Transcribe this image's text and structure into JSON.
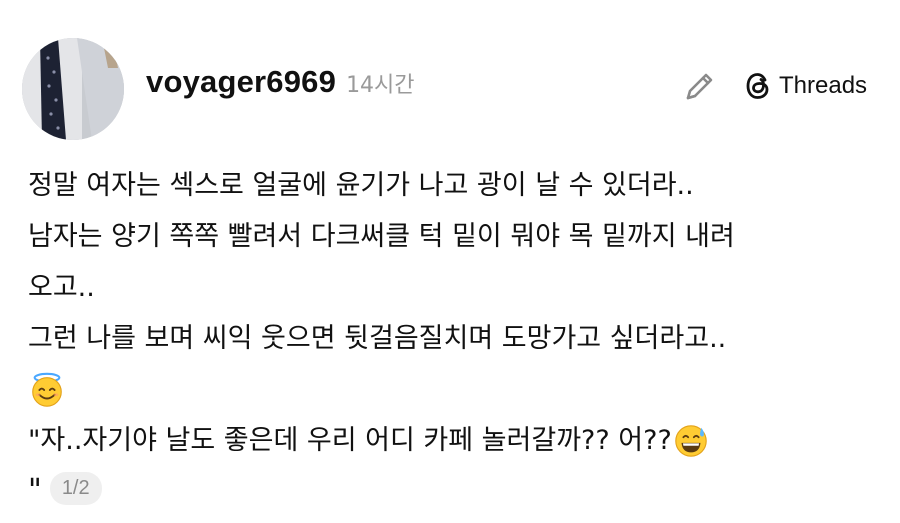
{
  "author": {
    "username": "voyager6969",
    "time_ago": "14시간"
  },
  "brand": {
    "label": "Threads"
  },
  "post": {
    "lines": [
      "정말 여자는 섹스로 얼굴에 윤기가 나고 광이 날 수 있더라..",
      "남자는 양기 쪽쪽 빨려서 다크써클 턱 밑이 뭐야 목 밑까지 내려",
      "오고..",
      "그런 나를 보며 씨익 웃으면 뒷걸음질치며 도망가고 싶더라고..",
      "\"자..자기야 날도 좋은데 우리 어디 카페 놀러갈까?? 어??"
    ],
    "emoji_halo": "smiling-face-with-halo",
    "emoji_sweat": "grinning-face-with-sweat"
  },
  "footer": {
    "quote_mark": "\"",
    "page_indicator": "1/2"
  },
  "colors": {
    "text": "#111111",
    "muted": "#9a9a9a",
    "pill_bg": "#efefef"
  }
}
